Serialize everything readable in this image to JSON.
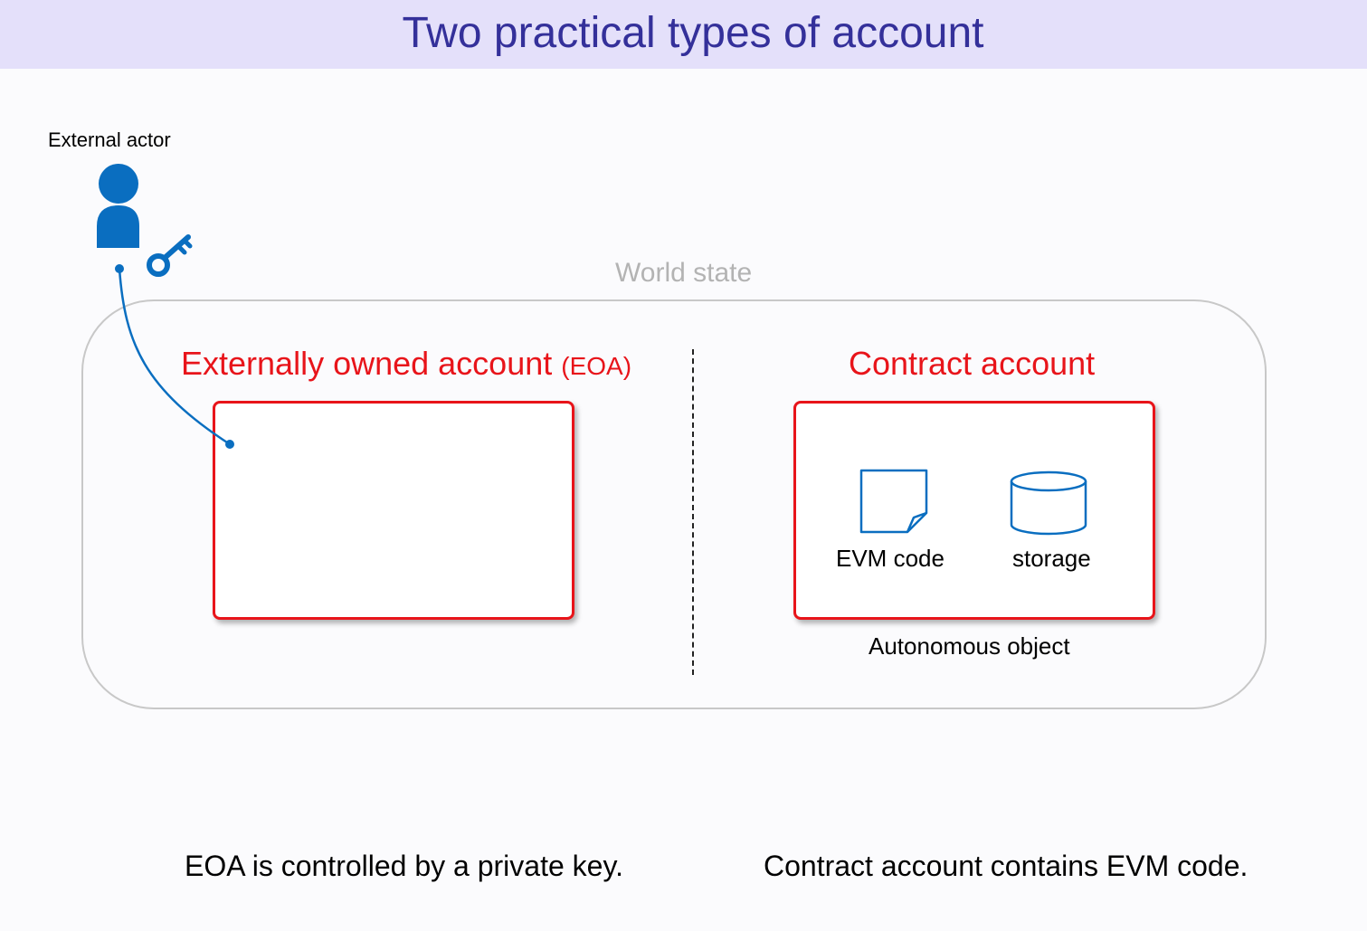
{
  "title": "Two practical types of account",
  "actor": {
    "label": "External actor"
  },
  "world_state": {
    "label": "World state"
  },
  "eoa": {
    "title": "Externally owned account",
    "title_suffix": "(EOA)"
  },
  "contract": {
    "title": "Contract account",
    "items": [
      {
        "label": "EVM code",
        "icon": "document-icon"
      },
      {
        "label": "storage",
        "icon": "database-icon"
      }
    ],
    "caption": "Autonomous object"
  },
  "footer": {
    "left": "EOA is controlled by a private key.",
    "right": "Contract account contains EVM code."
  },
  "colors": {
    "title_bar_bg": "#e4e0fa",
    "title_text": "#34309a",
    "account_red": "#e8141a",
    "icon_blue": "#0a6ec0",
    "world_border": "#c8c8c8"
  }
}
